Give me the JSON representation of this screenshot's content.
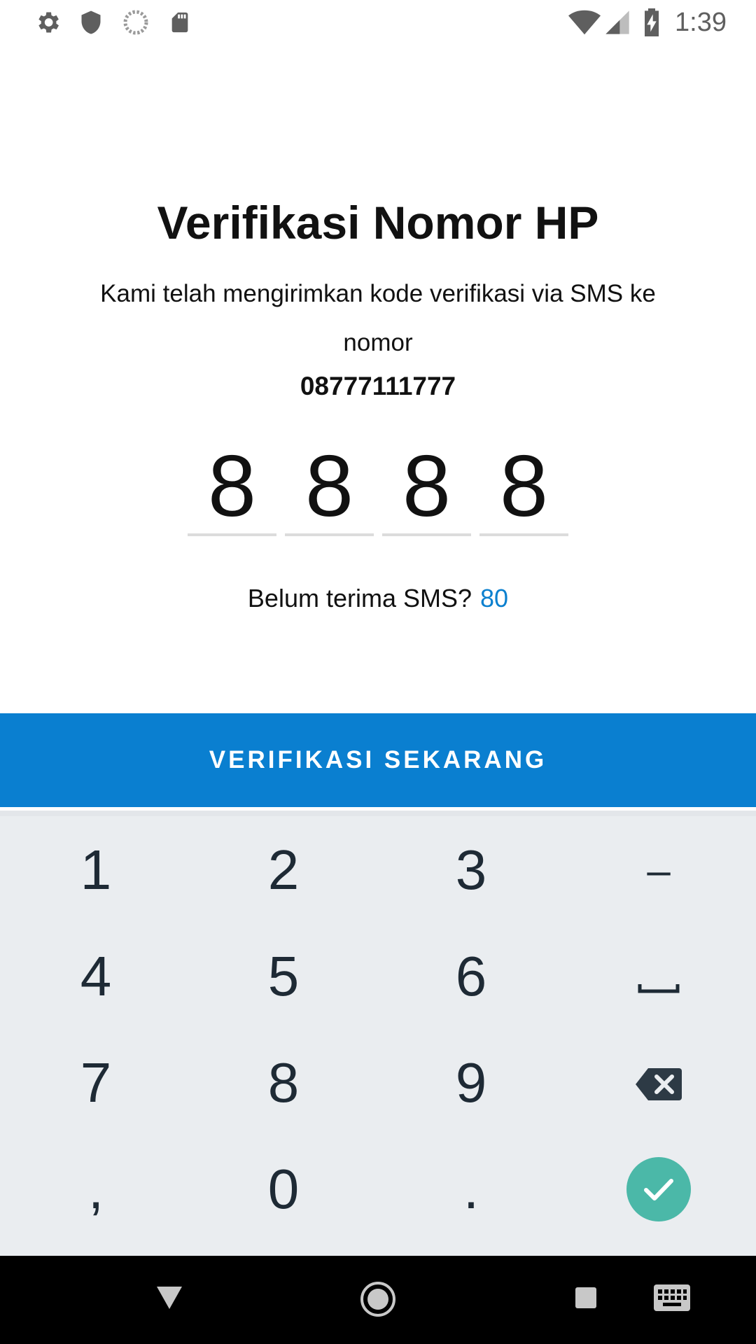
{
  "status_bar": {
    "time": "1:39",
    "icons": [
      "gear-icon",
      "shield-icon",
      "loading-icon",
      "sd-card-icon",
      "wifi-icon",
      "signal-icon",
      "battery-charging-icon"
    ]
  },
  "page": {
    "title": "Verifikasi Nomor HP",
    "subtitle": "Kami telah mengirimkan kode verifikasi via SMS ke nomor",
    "phone_number": "08777111777"
  },
  "otp": {
    "digits": [
      "8",
      "8",
      "8",
      "8"
    ]
  },
  "resend": {
    "label": "Belum terima SMS?",
    "countdown": "80"
  },
  "verify_button": {
    "label": "VERIFIKASI SEKARANG"
  },
  "keyboard": {
    "rows": [
      [
        "1",
        "2",
        "3",
        "–"
      ],
      [
        "4",
        "5",
        "6",
        "space"
      ],
      [
        "7",
        "8",
        "9",
        "backspace"
      ],
      [
        ",",
        "0",
        ".",
        "done"
      ]
    ]
  },
  "nav_bar": {
    "icons": [
      "back-icon",
      "home-icon",
      "recents-icon",
      "keyboard-icon"
    ]
  },
  "colors": {
    "accent": "#0a7fd0",
    "countdown": "#0b80cf",
    "keyboard_bg": "#eaedf0",
    "done_button": "#4bb8a8"
  }
}
